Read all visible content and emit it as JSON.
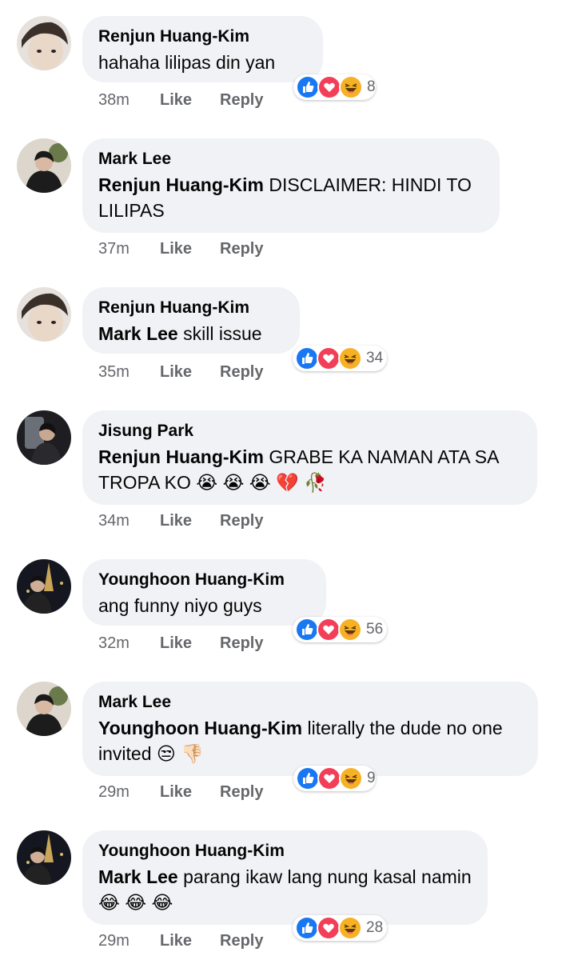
{
  "comments": [
    {
      "author": "Renjun Huang-Kim",
      "mention": "",
      "text": "hahaha lilipas din yan",
      "time": "38m",
      "like": "Like",
      "reply": "Reply",
      "reactions": "8"
    },
    {
      "author": "Mark Lee",
      "mention": "Renjun Huang-Kim",
      "text": "DISCLAIMER: HINDI TO LILIPAS",
      "time": "37m",
      "like": "Like",
      "reply": "Reply",
      "reactions": ""
    },
    {
      "author": "Renjun Huang-Kim",
      "mention": "Mark Lee",
      "text": "skill issue",
      "time": "35m",
      "like": "Like",
      "reply": "Reply",
      "reactions": "34"
    },
    {
      "author": "Jisung Park",
      "mention": "Renjun Huang-Kim",
      "text": "GRABE KA NAMAN ATA SA TROPA KO 😭 😭 😭 💔 🥀",
      "time": "34m",
      "like": "Like",
      "reply": "Reply",
      "reactions": ""
    },
    {
      "author": "Younghoon Huang-Kim",
      "mention": "",
      "text": "ang funny niyo guys",
      "time": "32m",
      "like": "Like",
      "reply": "Reply",
      "reactions": "56"
    },
    {
      "author": "Mark Lee",
      "mention": "Younghoon Huang-Kim",
      "text": "literally the dude no one invited 😒 👎🏻",
      "time": "29m",
      "like": "Like",
      "reply": "Reply",
      "reactions": "9"
    },
    {
      "author": "Younghoon Huang-Kim",
      "mention": "Mark Lee",
      "text": "parang ikaw lang nung kasal namin 😂 😂 😂",
      "time": "29m",
      "like": "Like",
      "reply": "Reply",
      "reactions": "28"
    }
  ],
  "colors": {
    "like_blue": "#1877f2",
    "love_red": "#f33e58",
    "haha_yellow": "#f7b125",
    "bubble": "#f0f2f5",
    "meta_gray": "#65676b"
  },
  "icons": [
    "like-reaction-icon",
    "love-reaction-icon",
    "haha-reaction-icon"
  ]
}
